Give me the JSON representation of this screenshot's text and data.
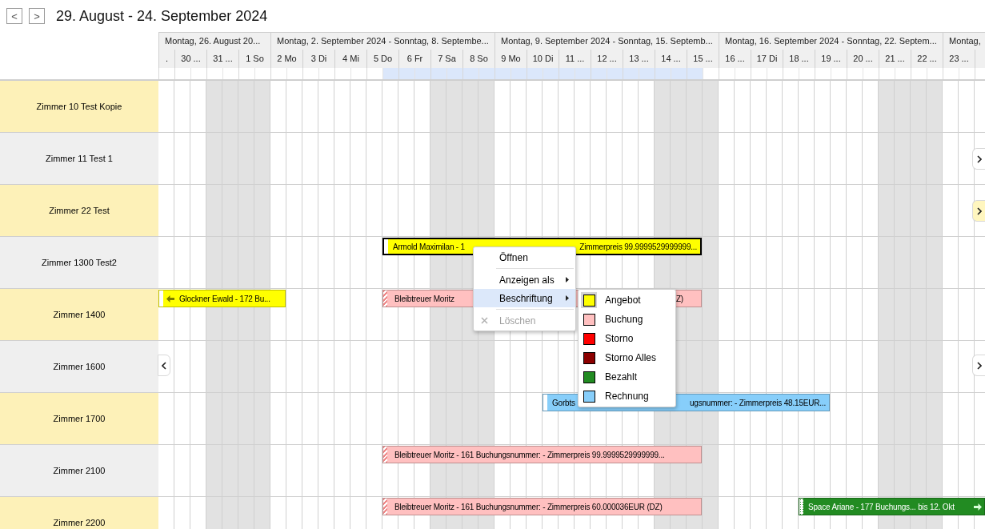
{
  "nav": {
    "prev": "<",
    "next": ">"
  },
  "title": "29. August - 24. September 2024",
  "weeks": [
    {
      "label": "Montag, 26. August 20...",
      "days": [
        {
          "label": ".",
          "weekend": false,
          "first_half_selected": false,
          "second_half_selected": false
        },
        {
          "label": "30 ...",
          "weekend": false,
          "first_half_selected": false,
          "second_half_selected": false
        },
        {
          "label": "31 ...",
          "weekend": true,
          "first_half_selected": false,
          "second_half_selected": false
        },
        {
          "label": "1 So",
          "weekend": true,
          "first_half_selected": false,
          "second_half_selected": false
        }
      ]
    },
    {
      "label": "Montag, 2. September 2024 - Sonntag, 8. Septembe...",
      "days": [
        {
          "label": "2 Mo",
          "weekend": false,
          "first_half_selected": false,
          "second_half_selected": false
        },
        {
          "label": "3 Di",
          "weekend": false,
          "first_half_selected": false,
          "second_half_selected": false
        },
        {
          "label": "4 Mi",
          "weekend": false,
          "first_half_selected": false,
          "second_half_selected": false
        },
        {
          "label": "5 Do",
          "weekend": false,
          "first_half_selected": false,
          "second_half_selected": true
        },
        {
          "label": "6 Fr",
          "weekend": false,
          "first_half_selected": true,
          "second_half_selected": true
        },
        {
          "label": "7 Sa",
          "weekend": true,
          "first_half_selected": true,
          "second_half_selected": true
        },
        {
          "label": "8 So",
          "weekend": true,
          "first_half_selected": true,
          "second_half_selected": true
        }
      ]
    },
    {
      "label": "Montag, 9. September 2024 - Sonntag, 15. Septemb...",
      "days": [
        {
          "label": "9 Mo",
          "weekend": false,
          "first_half_selected": true,
          "second_half_selected": true
        },
        {
          "label": "10 Di",
          "weekend": false,
          "first_half_selected": true,
          "second_half_selected": true
        },
        {
          "label": "11 ...",
          "weekend": false,
          "first_half_selected": true,
          "second_half_selected": true
        },
        {
          "label": "12 ...",
          "weekend": false,
          "first_half_selected": true,
          "second_half_selected": true
        },
        {
          "label": "13 ...",
          "weekend": false,
          "first_half_selected": true,
          "second_half_selected": true
        },
        {
          "label": "14 ...",
          "weekend": true,
          "first_half_selected": true,
          "second_half_selected": true
        },
        {
          "label": "15 ...",
          "weekend": true,
          "first_half_selected": true,
          "second_half_selected": false
        }
      ]
    },
    {
      "label": "Montag, 16. September 2024 - Sonntag, 22. Septem...",
      "days": [
        {
          "label": "16 ...",
          "weekend": false,
          "first_half_selected": false,
          "second_half_selected": false
        },
        {
          "label": "17 Di",
          "weekend": false,
          "first_half_selected": false,
          "second_half_selected": false
        },
        {
          "label": "18 ...",
          "weekend": false,
          "first_half_selected": false,
          "second_half_selected": false
        },
        {
          "label": "19 ...",
          "weekend": false,
          "first_half_selected": false,
          "second_half_selected": false
        },
        {
          "label": "20 ...",
          "weekend": false,
          "first_half_selected": false,
          "second_half_selected": false
        },
        {
          "label": "21 ...",
          "weekend": true,
          "first_half_selected": false,
          "second_half_selected": false
        },
        {
          "label": "22 ...",
          "weekend": true,
          "first_half_selected": false,
          "second_half_selected": false
        }
      ]
    },
    {
      "label": "Montag,",
      "days": [
        {
          "label": "23 ...",
          "weekend": false,
          "first_half_selected": false,
          "second_half_selected": false
        },
        {
          "weekend": false,
          "first_half_selected": false
        }
      ]
    }
  ],
  "rooms": [
    {
      "name": "Zimmer 10 Test Kopie"
    },
    {
      "name": "Zimmer 11 Test 1",
      "hints": [
        {
          "kind": "right",
          "color": "#ffffff"
        }
      ]
    },
    {
      "name": "Zimmer 22 Test",
      "hints": [
        {
          "kind": "right",
          "color": "#fff6bf"
        }
      ]
    },
    {
      "name": "Zimmer 1300 Test2",
      "bookings": [
        {
          "texts": [
            "Armold Maximilan - 1",
            "Zimmerpreis 99.9999529999999..."
          ],
          "color": "#ffff00",
          "kind": "plain",
          "selected": true,
          "continues_left": false,
          "continues_right": false
        }
      ]
    },
    {
      "name": "Zimmer 1400",
      "bookings": [
        {
          "texts": [
            "Glockner Ewald - 172 Bu..."
          ],
          "color": "#ffff00",
          "kind": "plain",
          "selected": false,
          "continues_left": true,
          "continues_right": false
        },
        {
          "texts": [
            "Bleibtreuer Moritz",
            "Z)"
          ],
          "color": "#ffc0c0",
          "kind": "hatched",
          "selected": false,
          "continues_left": false,
          "continues_right": false
        }
      ]
    },
    {
      "name": "Zimmer 1600",
      "hints": [
        {
          "kind": "left",
          "color": "#ffffff"
        },
        {
          "kind": "right",
          "color": "#ffffff"
        }
      ]
    },
    {
      "name": "Zimmer 1700",
      "bookings": [
        {
          "texts": [
            "Gorbts",
            "ugsnummer:  - Zimmerpreis 48.15EUR..."
          ],
          "color": "#87cefa",
          "kind": "plain",
          "selected": false,
          "continues_left": false,
          "continues_right": false
        }
      ]
    },
    {
      "name": "Zimmer 2100",
      "bookings": [
        {
          "texts": [
            "Bleibtreuer Moritz - 161 Buchungsnummer:  - Zimmerpreis 99.9999529999999..."
          ],
          "color": "#ffc0c0",
          "kind": "hatched",
          "selected": false,
          "continues_left": false,
          "continues_right": false
        }
      ]
    },
    {
      "name": "Zimmer 2200",
      "bookings": [
        {
          "texts": [
            "Bleibtreuer Moritz - 161 Buchungsnummer:  - Zimmerpreis 60.000036EUR (DZ)"
          ],
          "color": "#ffc0c0",
          "kind": "hatched",
          "selected": false,
          "continues_left": false,
          "continues_right": false
        },
        {
          "texts": [
            "Space Ariane - 177 Buchungs... bis 12. Okt"
          ],
          "color": "#228b22",
          "kind": "dotted",
          "selected": false,
          "continues_left": false,
          "continues_right": true
        }
      ]
    }
  ],
  "context_menu": {
    "items": [
      {
        "label": "Öffnen",
        "kind": "item",
        "disabled": false,
        "selected": false
      },
      {
        "kind": "separator"
      },
      {
        "label": "Anzeigen als",
        "kind": "submenu",
        "disabled": false,
        "selected": false
      },
      {
        "label": "Beschriftung",
        "kind": "submenu",
        "disabled": false,
        "selected": true
      },
      {
        "kind": "separator"
      },
      {
        "label": "Löschen",
        "kind": "delete",
        "disabled": true,
        "selected": false
      }
    ]
  },
  "label_menu": {
    "items": [
      {
        "label": "Angebot",
        "color": "#ffff00",
        "selected": true
      },
      {
        "label": "Buchung",
        "color": "#ffc0c0",
        "selected": false
      },
      {
        "label": "Storno",
        "color": "#ff0000",
        "selected": false
      },
      {
        "label": "Storno Alles",
        "color": "#8b0000",
        "selected": false
      },
      {
        "label": "Bezahlt",
        "color": "#228b22",
        "selected": false
      },
      {
        "label": "Rechnung",
        "color": "#87cefa",
        "selected": false
      }
    ]
  }
}
